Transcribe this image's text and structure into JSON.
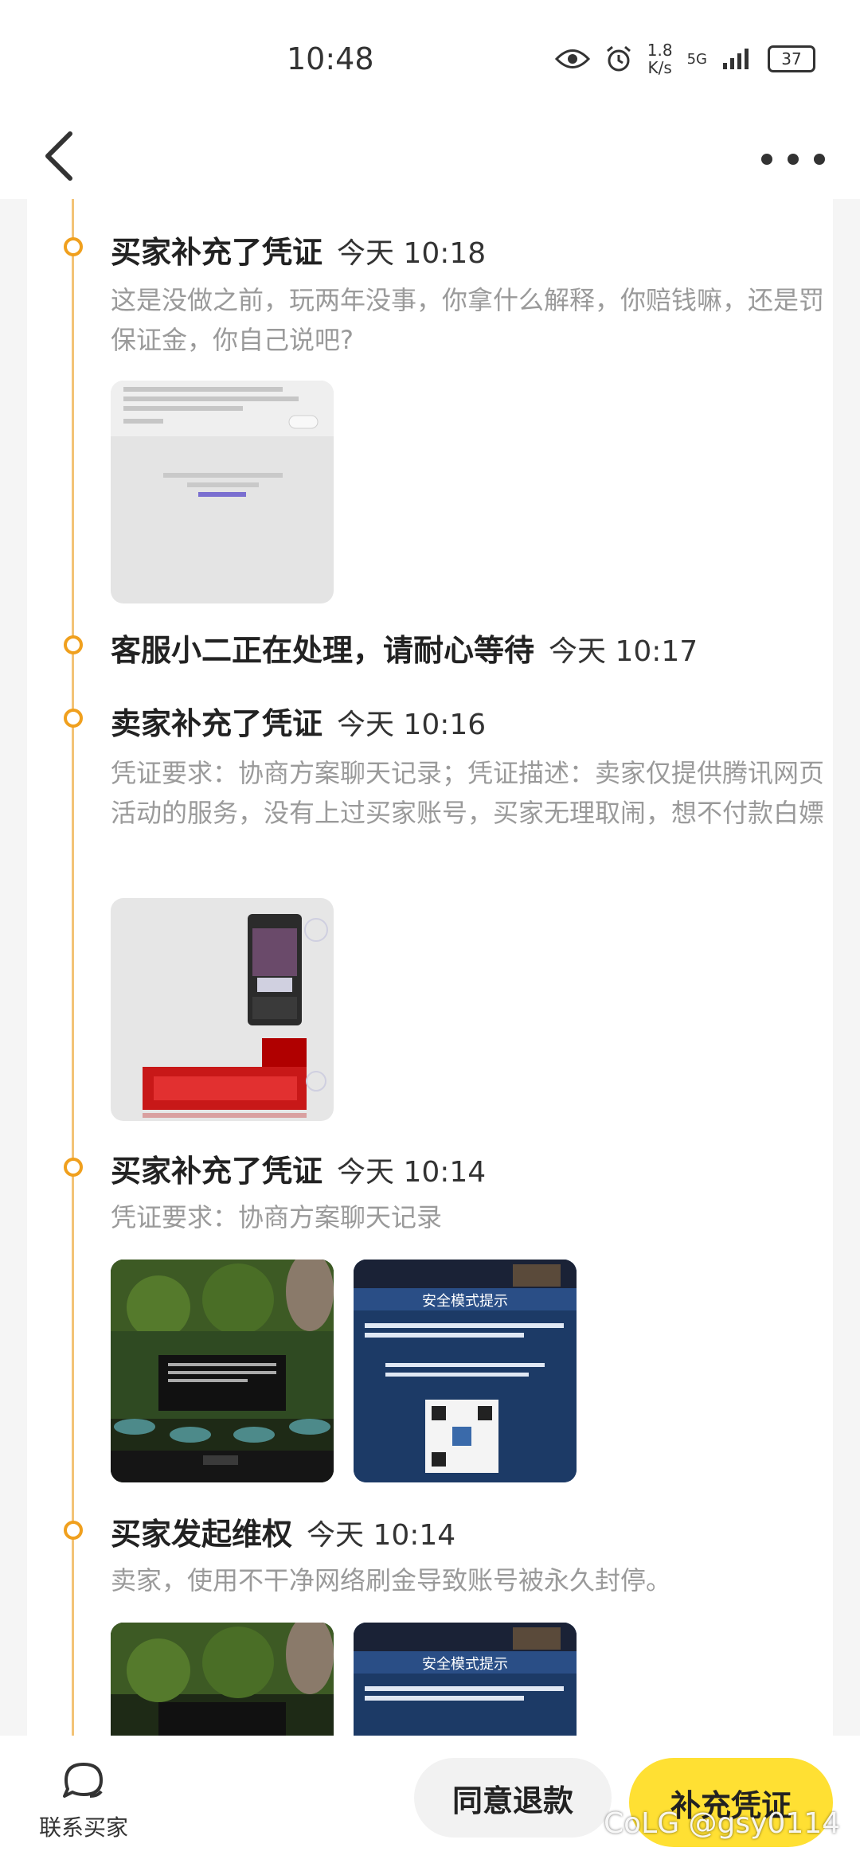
{
  "status_bar": {
    "time": "10:48",
    "speed_value": "1.8",
    "speed_unit": "K/s",
    "network": "5G",
    "battery": "37"
  },
  "header": {
    "back_icon": "chevron-left-icon",
    "more_icon": "more-horizontal-icon"
  },
  "timeline": [
    {
      "title": "买家补充了凭证",
      "time": "今天 10:18",
      "desc": "这是没做之前，玩两年没事，你拿什么解释，你赔钱嘛，还是罚保证金，你自己说吧?"
    },
    {
      "title": "客服小二正在处理，请耐心等待",
      "time": "今天 10:17"
    },
    {
      "title": "卖家补充了凭证",
      "time": "今天 10:16",
      "desc": "凭证要求：协商方案聊天记录；凭证描述：卖家仅提供腾讯网页活动的服务，没有上过买家账号，买家无理取闹，想不付款白嫖"
    },
    {
      "title": "买家补充了凭证",
      "time": "今天 10:14",
      "desc": "凭证要求：协商方案聊天记录",
      "overlay_title": "安全模式提示"
    },
    {
      "title": "买家发起维权",
      "time": "今天 10:14",
      "desc": "卖家，使用不干净网络刷金导致账号被永久封停。",
      "overlay_title": "安全模式提示"
    }
  ],
  "bottom_bar": {
    "contact_label": "联系买家",
    "agree_label": "同意退款",
    "supplement_label": "补充凭证",
    "watermark": "CoLG @gsy0114"
  },
  "colors": {
    "timeline_accent": "#f0a01e",
    "primary_button": "#ffe033"
  }
}
